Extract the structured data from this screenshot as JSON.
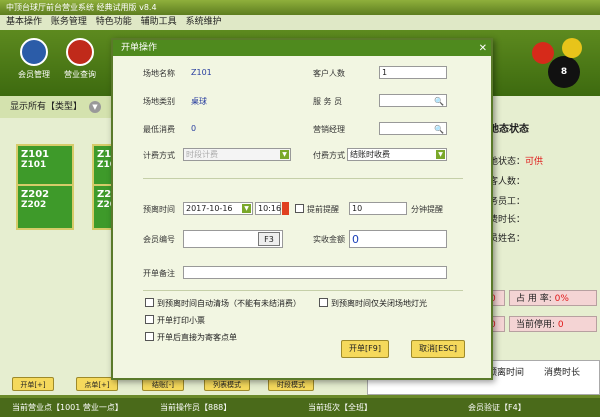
{
  "window": {
    "title": "中顶台球厅前台营业系统 经典试用版 v8.4"
  },
  "menu": [
    "基本操作",
    "账务管理",
    "特色功能",
    "辅助工具",
    "系统维护"
  ],
  "toolbar": {
    "buttons": [
      {
        "label": "会员管理",
        "icon": "member-icon",
        "color": "#2b5ca8"
      },
      {
        "label": "营业查询",
        "icon": "query-icon",
        "color": "#c02a1a"
      }
    ]
  },
  "left": {
    "header": "显示所有【类型】",
    "tables": [
      {
        "code": "Z101",
        "name": "Z101"
      },
      {
        "code": "Z102",
        "name": "Z10"
      },
      {
        "code": "Z202",
        "name": "Z202"
      },
      {
        "code": "Z20",
        "name": "Z20"
      }
    ]
  },
  "right": {
    "title": "地态状态",
    "rows": [
      "地状态：",
      "客人数：",
      "务员工：",
      "费时长：",
      "员姓名："
    ],
    "status_value": "可供",
    "stats": [
      {
        "label": "0",
        "color": "#e01818"
      },
      {
        "label": "占 用 率:",
        "value": "0%",
        "color": "#e01818"
      },
      {
        "label": "0",
        "color": "#e01818"
      },
      {
        "label": "当前停用:",
        "value": "0",
        "color": "#e01818"
      }
    ],
    "grid_headers": [
      "预离时间",
      "消费时长"
    ]
  },
  "bottom_buttons": [
    "开单[+]",
    "点单[+]",
    "结账[-]",
    "列表模式",
    "时段模式"
  ],
  "statusbar": {
    "s1": "当前营业点【1001 营业一点】",
    "s2": "当前操作员【888】",
    "s3": "当前班次【全班】",
    "s4": "会员验证【F4】"
  },
  "dialog": {
    "title": "开单操作",
    "fields": {
      "venue_name_label": "场地名称",
      "venue_name": "Z101",
      "venue_type_label": "场地类别",
      "venue_type": "桌球",
      "min_spend_label": "最低消费",
      "min_spend": "0",
      "billing_label": "计费方式",
      "billing": "时段计费",
      "guests_label": "客户人数",
      "guests": "1",
      "waiter_label": "服 务 员",
      "waiter": "",
      "manager_label": "营销经理",
      "manager": "",
      "pay_label": "付费方式",
      "pay": "结账时收费",
      "leave_time_label": "预离时间",
      "leave_date": "2017-10-16",
      "leave_time": "10:16",
      "remind_label": "提前提醒",
      "remind_value": "10",
      "remind_unit": "分钟提醒",
      "member_label": "会员编号",
      "member_key": "F3",
      "paid_label": "实收金额",
      "paid": "0",
      "note_label": "开单备注",
      "note": ""
    },
    "options": [
      "到预离时间自动清场（不能有未结消费）",
      "到预离时间仅关闭场地灯光",
      "开单打印小票",
      "开单后直接为寄客点单"
    ],
    "ok_label": "开单[F9]",
    "cancel_label": "取消[ESC]"
  }
}
